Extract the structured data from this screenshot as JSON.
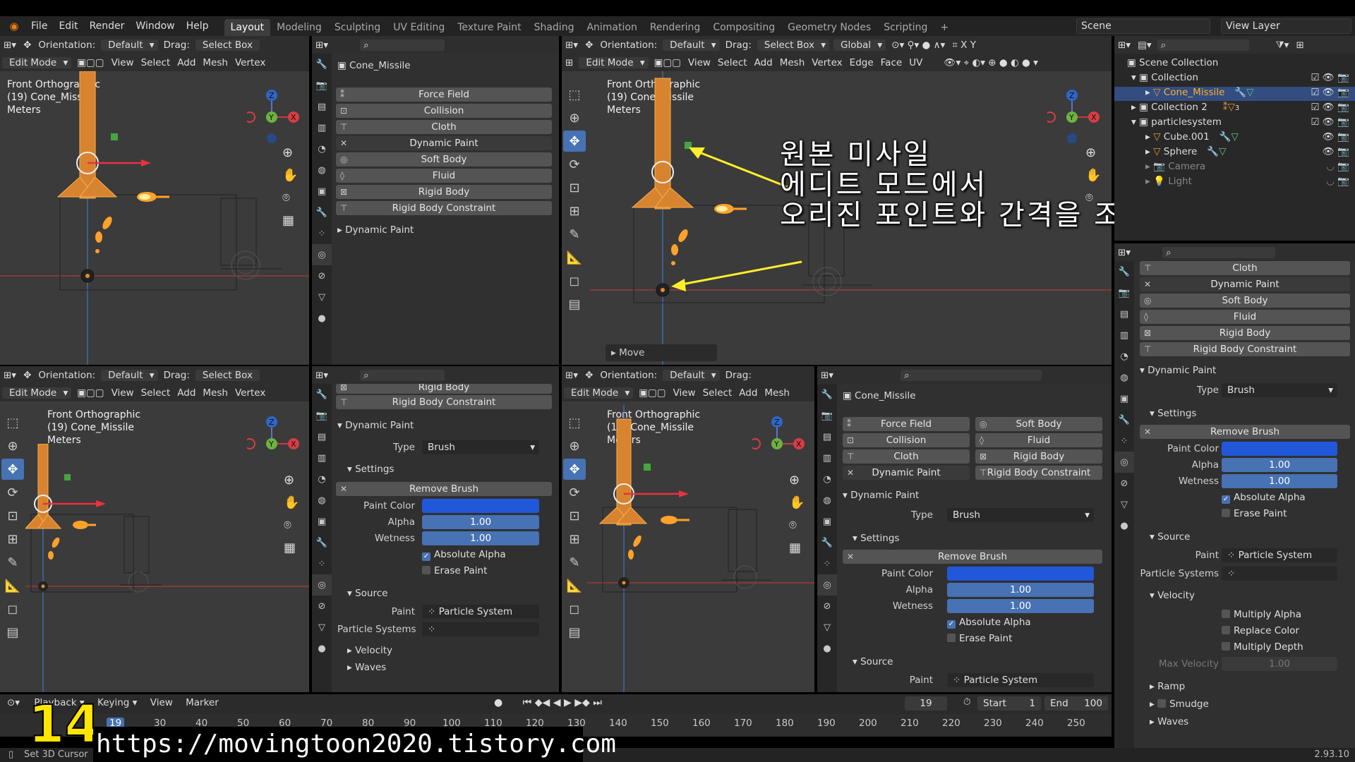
{
  "menu": {
    "items": [
      "File",
      "Edit",
      "Render",
      "Window",
      "Help"
    ]
  },
  "workspaces": [
    "Layout",
    "Modeling",
    "Sculpting",
    "UV Editing",
    "Texture Paint",
    "Shading",
    "Animation",
    "Rendering",
    "Compositing",
    "Geometry Nodes",
    "Scripting"
  ],
  "scene": "Scene",
  "view_layer": "View Layer",
  "vp_header": {
    "orientation": "Orientation:",
    "default": "Default",
    "drag": "Drag:",
    "select_box": "Select Box",
    "global": "Global",
    "edit_mode": "Edit Mode",
    "menus": [
      "View",
      "Select",
      "Add",
      "Mesh",
      "Vertex",
      "Edge",
      "Face",
      "UV"
    ]
  },
  "vp_overlay": {
    "line1": "Front Orthographic",
    "line2": "(19) Cone_Missile",
    "line3": "Meters"
  },
  "move_panel": "Move",
  "props": {
    "object_name": "Cone_Missile",
    "physics": [
      "Force Field",
      "Collision",
      "Cloth",
      "Dynamic Paint",
      "Soft Body",
      "Fluid",
      "Rigid Body",
      "Rigid Body Constraint"
    ],
    "dynamic_paint": "Dynamic Paint",
    "type_label": "Type",
    "type_value": "Brush",
    "settings": "Settings",
    "remove_brush": "Remove Brush",
    "paint_color": "Paint Color",
    "alpha": "Alpha",
    "alpha_value": "1.00",
    "wetness": "Wetness",
    "wetness_value": "1.00",
    "absolute_alpha": "Absolute Alpha",
    "erase_paint": "Erase Paint",
    "source": "Source",
    "paint_label": "Paint",
    "paint_value": "Particle System",
    "particle_systems": "Particle Systems",
    "velocity": "Velocity",
    "waves": "Waves",
    "multiply_alpha": "Multiply Alpha",
    "replace_color": "Replace Color",
    "multiply_depth": "Multiply Depth",
    "max_velocity": "Max Velocity",
    "max_velocity_value": "1.00",
    "ramp": "Ramp",
    "smudge": "Smudge"
  },
  "outliner": {
    "rows": [
      "Scene Collection",
      "Collection",
      "Cone_Missile",
      "Collection 2",
      "particlesystem",
      "Cube.001",
      "Sphere",
      "Camera",
      "Light"
    ],
    "collection2_count": "3"
  },
  "timeline": {
    "menus": [
      "Playback",
      "Keying",
      "View",
      "Marker"
    ],
    "current": "19",
    "start_label": "Start",
    "start": "1",
    "end_label": "End",
    "end": "100",
    "ticks": [
      "19",
      "30",
      "40",
      "50",
      "60",
      "70",
      "80",
      "90",
      "100",
      "110",
      "120",
      "130",
      "140",
      "150",
      "160",
      "170",
      "180",
      "190",
      "200",
      "210",
      "220",
      "230",
      "240",
      "250"
    ]
  },
  "status": {
    "left": "Set 3D Cursor",
    "version": "2.93.10"
  },
  "annotation": {
    "line1": "원본 미사일",
    "line2": "에디트 모드에서",
    "line3": "오리진 포인트와 간격을 조절한다"
  },
  "watermark": {
    "number": "14",
    "url": "https://movingtoon2020.tistory.com"
  },
  "axes": {
    "x": "X",
    "y": "Y",
    "z": "Z"
  }
}
